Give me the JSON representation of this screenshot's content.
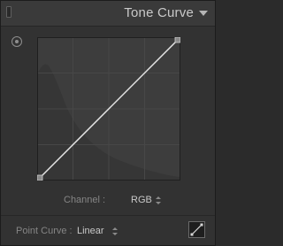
{
  "panel": {
    "title": "Tone Curve",
    "collapse_icon": "panel-switch-icon",
    "expand_icon": "triangle-down-icon"
  },
  "tool": {
    "icon": "target-adjustment-icon"
  },
  "curve": {
    "points": [
      {
        "input": 0,
        "output": 0
      },
      {
        "input": 255,
        "output": 255
      }
    ],
    "line_color": "#e6e6e6",
    "background_color": "#3d3d3d",
    "grid_color": "#4a4a4a"
  },
  "channel": {
    "label": "Channel :",
    "value": "RGB"
  },
  "point_curve": {
    "label": "Point Curve :",
    "value": "Linear",
    "edit_icon": "edit-point-curve-icon"
  }
}
